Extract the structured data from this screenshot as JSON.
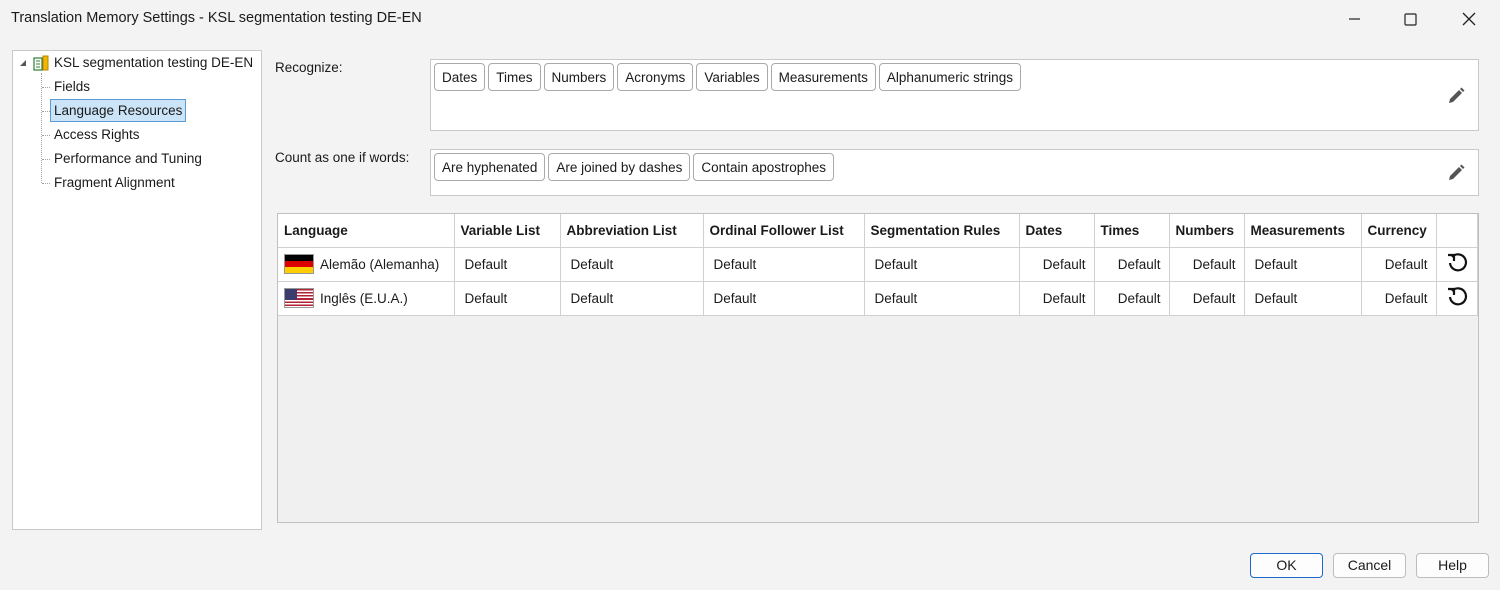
{
  "window": {
    "title": "Translation Memory Settings - KSL segmentation testing DE-EN"
  },
  "tree": {
    "root": "KSL segmentation testing DE-EN",
    "items": [
      "Fields",
      "Language Resources",
      "Access Rights",
      "Performance and Tuning",
      "Fragment Alignment"
    ],
    "selected": "Language Resources"
  },
  "recognize": {
    "label": "Recognize:",
    "tags": [
      "Dates",
      "Times",
      "Numbers",
      "Acronyms",
      "Variables",
      "Measurements",
      "Alphanumeric strings"
    ]
  },
  "count_as_one": {
    "label": "Count as one if words:",
    "tags": [
      "Are hyphenated",
      "Are joined by dashes",
      "Contain apostrophes"
    ]
  },
  "table": {
    "headers": [
      "Language",
      "Variable List",
      "Abbreviation List",
      "Ordinal Follower List",
      "Segmentation Rules",
      "Dates",
      "Times",
      "Numbers",
      "Measurements",
      "Currency"
    ],
    "rows": [
      {
        "language": "Alemão (Alemanha)",
        "flag": "flag-germany",
        "cells": [
          "Default",
          "Default",
          "Default",
          "Default",
          "Default",
          "Default",
          "Default",
          "Default",
          "Default"
        ]
      },
      {
        "language": "Inglês (E.U.A.)",
        "flag": "flag-usa",
        "cells": [
          "Default",
          "Default",
          "Default",
          "Default",
          "Default",
          "Default",
          "Default",
          "Default",
          "Default"
        ]
      }
    ]
  },
  "buttons": {
    "ok": "OK",
    "cancel": "Cancel",
    "help": "Help"
  },
  "colors": {
    "selection_bg": "#cce4f7",
    "selection_border": "#5b9bd5",
    "ok_border": "#1b6ac9"
  }
}
